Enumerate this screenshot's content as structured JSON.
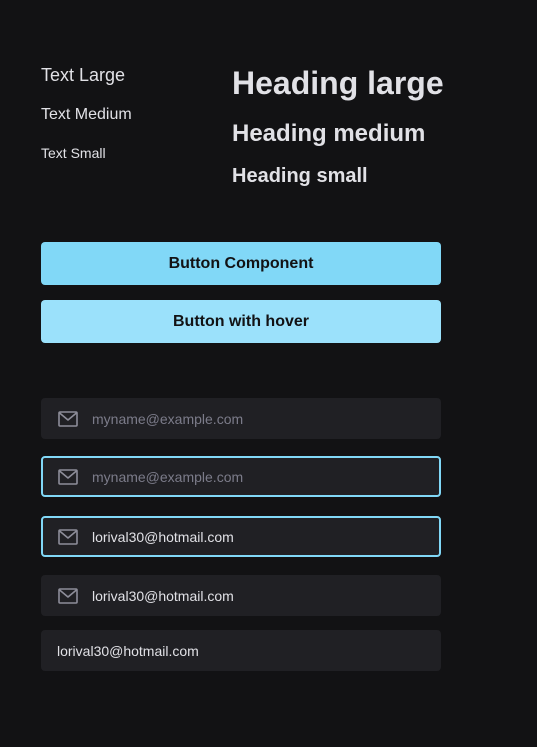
{
  "typography": {
    "text_large": "Text Large",
    "text_medium": "Text Medium",
    "text_small": "Text Small",
    "heading_large": "Heading large",
    "heading_medium": "Heading medium",
    "heading_small": "Heading small"
  },
  "buttons": {
    "primary_label": "Button Component",
    "hover_label": "Button with hover"
  },
  "inputs": [
    {
      "state": "default",
      "icon": "mail-icon",
      "value": "",
      "placeholder": "myname@example.com"
    },
    {
      "state": "focused",
      "icon": "mail-icon",
      "value": "",
      "placeholder": "myname@example.com"
    },
    {
      "state": "focused-filled",
      "icon": "mail-icon",
      "value": "lorival30@hotmail.com",
      "placeholder": ""
    },
    {
      "state": "filled",
      "icon": "mail-icon",
      "value": "lorival30@hotmail.com",
      "placeholder": ""
    },
    {
      "state": "filled-no-icon",
      "value": "lorival30@hotmail.com",
      "placeholder": ""
    }
  ],
  "colors": {
    "background": "#121214",
    "input_background": "#202024",
    "accent": "#81d8f7",
    "accent_hover": "#9be1fb",
    "text": "#e1e1e6",
    "placeholder": "#7c7c8a"
  }
}
